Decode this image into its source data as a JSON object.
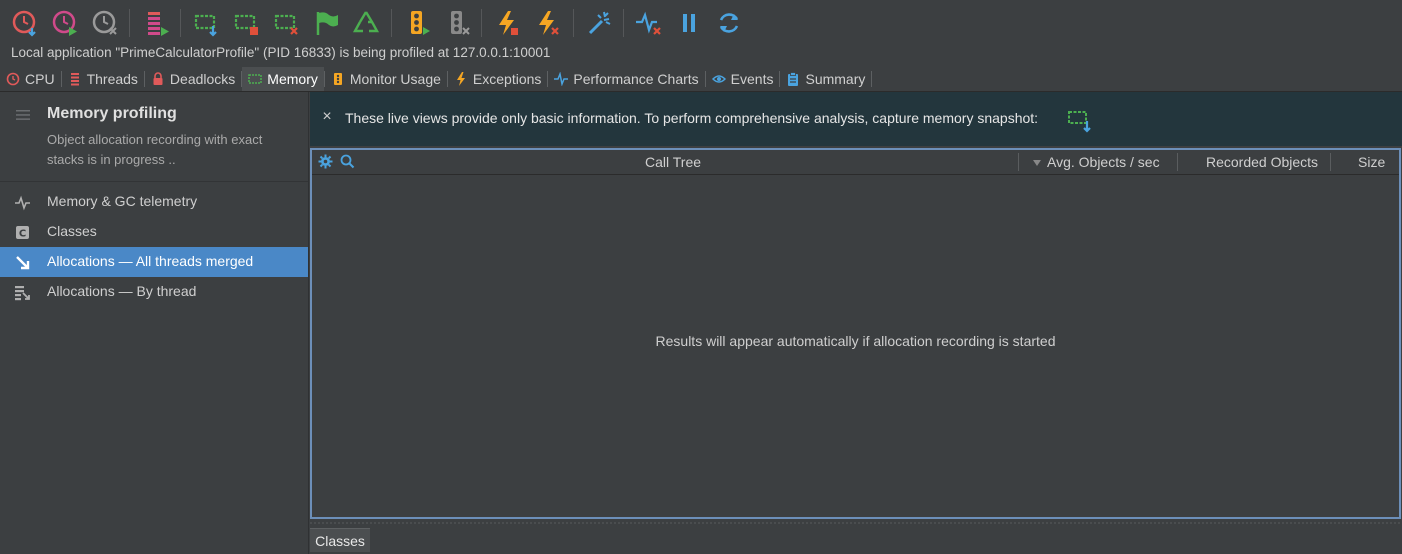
{
  "toolbar": {
    "buttons": [
      {
        "name": "cpu-snapshot-icon",
        "color": "#e05a5a"
      },
      {
        "name": "start-cpu-recording-icon",
        "color": "#d04a8a"
      },
      {
        "name": "stop-cpu-recording-icon",
        "color": "#9a9a9a"
      },
      {
        "name": "start-thread-recording-icon",
        "color": "#d04a8a"
      },
      {
        "name": "capture-memory-snapshot-icon",
        "color": "#4caf50"
      },
      {
        "name": "start-allocation-recording-icon",
        "color": "#4caf50"
      },
      {
        "name": "stop-allocation-recording-icon",
        "color": "#4caf50"
      },
      {
        "name": "advance-object-generation-icon",
        "color": "#4caf50"
      },
      {
        "name": "force-gc-icon",
        "color": "#4caf50"
      },
      {
        "name": "start-monitor-profiling-icon",
        "color": "#f5a623"
      },
      {
        "name": "stop-monitor-profiling-icon",
        "color": "#9a9a9a"
      },
      {
        "name": "start-exception-telemetry-icon",
        "color": "#f5a623"
      },
      {
        "name": "stop-exception-telemetry-icon",
        "color": "#f5a623"
      },
      {
        "name": "trigger-icon",
        "color": "#4aa3df"
      },
      {
        "name": "telemetry-stop-icon",
        "color": "#4aa3df"
      },
      {
        "name": "pause-icon",
        "color": "#4aa3df"
      },
      {
        "name": "refresh-icon",
        "color": "#4aa3df"
      }
    ]
  },
  "status": {
    "text": "Local application \"PrimeCalculatorProfile\" (PID 16833) is being profiled at 127.0.0.1:10001"
  },
  "tabs": [
    {
      "label": "CPU",
      "icon": "cpu-icon",
      "color": "#e05a5a"
    },
    {
      "label": "Threads",
      "icon": "threads-icon",
      "color": "#e05a5a"
    },
    {
      "label": "Deadlocks",
      "icon": "lock-icon",
      "color": "#e05a5a"
    },
    {
      "label": "Memory",
      "icon": "memory-icon",
      "color": "#4caf50",
      "active": true
    },
    {
      "label": "Monitor Usage",
      "icon": "monitor-usage-icon",
      "color": "#f5a623"
    },
    {
      "label": "Exceptions",
      "icon": "lightning-icon",
      "color": "#f5a623"
    },
    {
      "label": "Performance Charts",
      "icon": "pulse-icon",
      "color": "#4aa3df"
    },
    {
      "label": "Events",
      "icon": "eye-icon",
      "color": "#4aa3df"
    },
    {
      "label": "Summary",
      "icon": "clipboard-icon",
      "color": "#4aa3df"
    }
  ],
  "sidebar": {
    "title": "Memory profiling",
    "description": "Object allocation recording with exact stacks is in progress ..",
    "items": [
      {
        "label": "Memory & GC telemetry",
        "icon": "pulse-icon"
      },
      {
        "label": "Classes",
        "icon": "class-icon"
      },
      {
        "label": "Allocations — All threads merged",
        "icon": "allocation-arrow-icon",
        "selected": true
      },
      {
        "label": "Allocations — By thread",
        "icon": "allocation-thread-icon"
      }
    ]
  },
  "banner": {
    "close": "×",
    "text": "These live views provide only basic information. To perform comprehensive analysis, capture memory snapshot:"
  },
  "table": {
    "columns": [
      "Call Tree",
      "Avg. Objects / sec",
      "Recorded Objects",
      "Size"
    ],
    "sorted_column": "Avg. Objects / sec",
    "empty_message": "Results will appear automatically if allocation recording is started"
  },
  "bottom_tabs": {
    "active": "Classes"
  }
}
